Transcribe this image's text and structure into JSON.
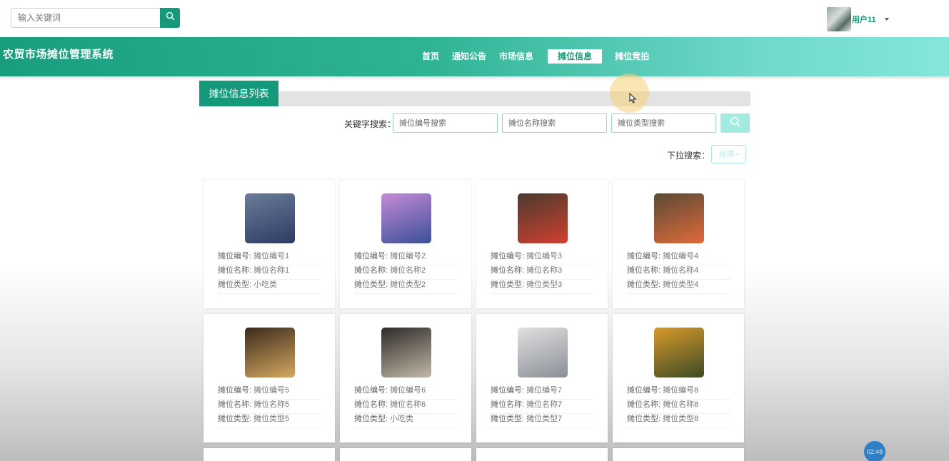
{
  "top": {
    "search_placeholder": "输入关键词",
    "user_name": "用户11"
  },
  "nav": {
    "site_title": "农贸市场摊位管理系统",
    "items": [
      {
        "label": "首页",
        "active": false
      },
      {
        "label": "通知公告",
        "active": false
      },
      {
        "label": "市场信息",
        "active": false
      },
      {
        "label": "摊位信息",
        "active": true
      },
      {
        "label": "摊位竞拍",
        "active": false
      }
    ]
  },
  "section": {
    "title": "摊位信息列表"
  },
  "filters": {
    "keyword_label": "关键字搜索：",
    "placeholders": [
      "摊位编号搜索",
      "摊位名称搜索",
      "摊位类型搜索"
    ],
    "dropdown_label": "下拉搜索：",
    "sort_label": "排序"
  },
  "cards": [
    {
      "code_key": "摊位编号:",
      "code": "摊位编号1",
      "name_key": "摊位名称:",
      "name": "摊位名称1",
      "type_key": "摊位类型:",
      "type": "小吃类",
      "img_a": "#6b7d99",
      "img_b": "#2d3a63"
    },
    {
      "code_key": "摊位编号:",
      "code": "摊位编号2",
      "name_key": "摊位名称:",
      "name": "摊位名称2",
      "type_key": "摊位类型:",
      "type": "摊位类型2",
      "img_a": "#c58bd6",
      "img_b": "#3a4f9a"
    },
    {
      "code_key": "摊位编号:",
      "code": "摊位编号3",
      "name_key": "摊位名称:",
      "name": "摊位名称3",
      "type_key": "摊位类型:",
      "type": "摊位类型3",
      "img_a": "#4a3a2e",
      "img_b": "#d04030"
    },
    {
      "code_key": "摊位编号:",
      "code": "摊位编号4",
      "name_key": "摊位名称:",
      "name": "摊位名称4",
      "type_key": "摊位类型:",
      "type": "摊位类型4",
      "img_a": "#5a4a35",
      "img_b": "#e06a3a"
    },
    {
      "code_key": "摊位编号:",
      "code": "摊位编号5",
      "name_key": "摊位名称:",
      "name": "摊位名称5",
      "type_key": "摊位类型:",
      "type": "摊位类型5",
      "img_a": "#3a2a1c",
      "img_b": "#d6a860"
    },
    {
      "code_key": "摊位编号:",
      "code": "摊位编号6",
      "name_key": "摊位名称:",
      "name": "摊位名称6",
      "type_key": "摊位类型:",
      "type": "小吃类",
      "img_a": "#2e2a28",
      "img_b": "#c2b9a8"
    },
    {
      "code_key": "摊位编号:",
      "code": "摊位编号7",
      "name_key": "摊位名称:",
      "name": "摊位名称7",
      "type_key": "摊位类型:",
      "type": "摊位类型7",
      "img_a": "#e0e0e0",
      "img_b": "#8a8f96"
    },
    {
      "code_key": "摊位编号:",
      "code": "摊位编号8",
      "name_key": "摊位名称:",
      "name": "摊位名称8",
      "type_key": "摊位类型:",
      "type": "摊位类型8",
      "img_a": "#d89a2a",
      "img_b": "#3d4a26"
    }
  ],
  "timer": "02:48"
}
